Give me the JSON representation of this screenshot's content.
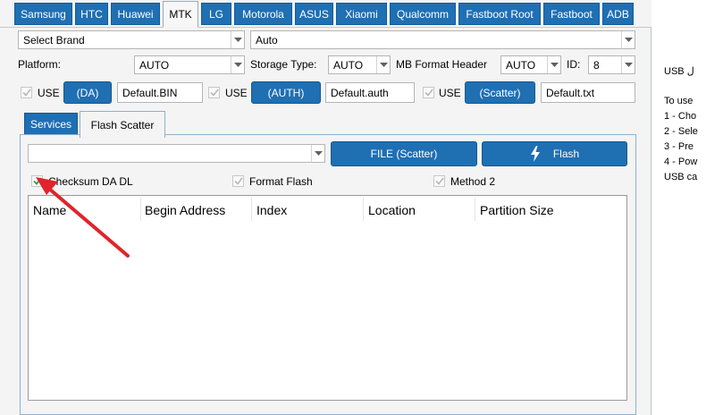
{
  "tabs": [
    "Samsung",
    "HTC",
    "Huawei",
    "MTK",
    "LG",
    "Motorola",
    "ASUS",
    "Xiaomi",
    "Qualcomm",
    "Fastboot Root",
    "Fastboot",
    "ADB"
  ],
  "active_tab": "MTK",
  "brand_select": {
    "value": "Select Brand"
  },
  "model_select": {
    "value": "Auto"
  },
  "platform": {
    "label": "Platform:",
    "value": "AUTO"
  },
  "storage_type": {
    "label": "Storage Type:",
    "value": "AUTO"
  },
  "mb_format_header": {
    "label": "MB Format Header",
    "value": "AUTO"
  },
  "id_field": {
    "label": "ID:",
    "value": "8"
  },
  "use_da": {
    "label": "USE",
    "button": "(DA)",
    "file": "Default.BIN"
  },
  "use_auth": {
    "label": "USE",
    "button": "(AUTH)",
    "file": "Default.auth"
  },
  "use_scatter": {
    "label": "USE",
    "button": "(Scatter)",
    "file": "Default.txt"
  },
  "inner_tabs": [
    "Services",
    "Flash Scatter"
  ],
  "active_inner_tab": "Flash Scatter",
  "scatter_select": {
    "value": ""
  },
  "file_scatter_button": "FILE (Scatter)",
  "flash_button": "Flash",
  "options": {
    "checksum": {
      "label": "Checksum DA DL",
      "checked": true
    },
    "format_flash": {
      "label": "Format  Flash",
      "checked": true
    },
    "method2": {
      "label": "Method 2",
      "checked": true
    }
  },
  "table_columns": [
    "Name",
    "Begin Address",
    "Index",
    "Location",
    "Partition Size"
  ],
  "side_panel": {
    "line1": "USB ل",
    "line2": "To use",
    "line3": "1 - Cho",
    "line4": "2 - Sele",
    "line5": "3 - Pre",
    "line6": "4 - Pow",
    "line7": "USB ca"
  },
  "annotation_color": "#e0242b",
  "accent_color": "#1f6fb3"
}
